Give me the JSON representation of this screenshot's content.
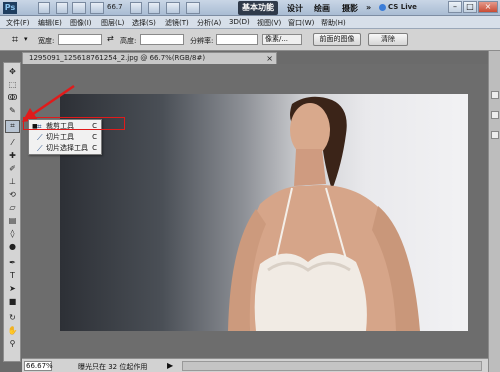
{
  "titlebar": {
    "logo": "Ps",
    "zoom": "66.7",
    "workspaces": [
      "基本功能",
      "设计",
      "绘画",
      "摄影"
    ],
    "more": "»",
    "cslive": "CS Live",
    "window_buttons": [
      "–",
      "□",
      "×"
    ]
  },
  "menubar": {
    "items": [
      "文件(F)",
      "编辑(E)",
      "图像(I)",
      "图层(L)",
      "选择(S)",
      "滤镜(T)",
      "分析(A)",
      "3D(D)",
      "视图(V)",
      "窗口(W)",
      "帮助(H)"
    ]
  },
  "options": {
    "width_label": "宽度:",
    "height_label": "高度:",
    "resolution_label": "分辨率:",
    "units": "像素/...",
    "front_image_button": "前面的图像",
    "clear_button": "清除",
    "swap_symbol": "⇄"
  },
  "document": {
    "tab_title": "1295091_125618761254_2.jpg @ 66.7%(RGB/8#)",
    "close": "×"
  },
  "flyout": {
    "items": [
      {
        "label": "裁剪工具",
        "key": "C",
        "selected": true
      },
      {
        "label": "切片工具",
        "key": "C",
        "selected": false
      },
      {
        "label": "切片选择工具",
        "key": "C",
        "selected": false
      }
    ]
  },
  "statusbar": {
    "zoom": "66.67%",
    "info": "曝光只在 32 位起作用",
    "arrow": "▶"
  },
  "colors": {
    "highlight": "#e01b1b",
    "workspace_active": "#2f3a4a"
  }
}
